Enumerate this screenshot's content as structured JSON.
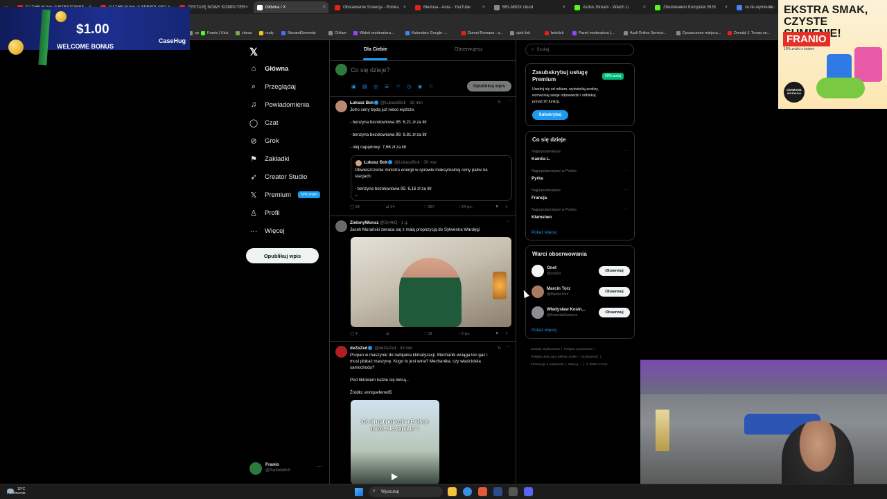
{
  "browser": {
    "tabs": [
      {
        "label": "DJ THE M live at RZESZOWSK",
        "color": "#e62117"
      },
      {
        "label": "DJ THE M live at SPEEDLAND",
        "color": "#e62117"
      },
      {
        "label": "TESTUJĘ NOWY KOMPUTER",
        "color": "#e62117"
      },
      {
        "label": "Główna / X",
        "color": "#ffffff",
        "active": true
      },
      {
        "label": "Obstawianie Szwecja - Polska",
        "color": "#e62117"
      },
      {
        "label": "Medusa - Aura - YouTube",
        "color": "#e62117"
      },
      {
        "label": "BELABOX cloud",
        "color": "#888888"
      },
      {
        "label": "Azdus Stream - Watch Li",
        "color": "#53fc18"
      },
      {
        "label": "Zbudowałem Komputer BUS",
        "color": "#53fc18"
      },
      {
        "label": "co ile wymienia się",
        "color": "#4285f4"
      }
    ],
    "bookmarks": [
      {
        "label": "op",
        "color": "#888888"
      },
      {
        "label": "Franio | Kick",
        "color": "#53fc18"
      },
      {
        "label": "chess",
        "color": "#7fa650"
      },
      {
        "label": "nudy",
        "color": "#f5c518"
      },
      {
        "label": "StreamElements",
        "color": "#4b6bfb"
      },
      {
        "label": "Chilam",
        "color": "#888888"
      },
      {
        "label": "Widok moderatora...",
        "color": "#9146ff"
      },
      {
        "label": "Kalendarz Google -...",
        "color": "#4285f4"
      },
      {
        "label": "Domni Romana - a...",
        "color": "#e62117"
      },
      {
        "label": "ujeb link",
        "color": "#888888"
      },
      {
        "label": "betclick",
        "color": "#e62117"
      },
      {
        "label": "Panel moderatora |...",
        "color": "#9146ff"
      },
      {
        "label": "Audi Online Service...",
        "color": "#888888"
      },
      {
        "label": "Opuszczone miejsca...",
        "color": "#888888"
      },
      {
        "label": "Donald J. Trump ne...",
        "color": "#e62117"
      }
    ]
  },
  "ads": {
    "left": {
      "amount": "$1.00",
      "bonus": "WELCOME BONUS",
      "brand": "CaseHug"
    },
    "right": {
      "headline": "EKSTRA SMAK, CZYSTE SUMIENIE!",
      "brand": "FRANIO",
      "sub": "10% zniżki z kodem",
      "badge": "DARMOWA WYSYŁKA"
    }
  },
  "nav": {
    "logo": "𝕏",
    "items": [
      {
        "label": "Główna",
        "icon": "home-icon",
        "glyph": "⌂"
      },
      {
        "label": "Przeglądaj",
        "icon": "search-icon",
        "glyph": "⌕"
      },
      {
        "label": "Powiadomienia",
        "icon": "bell-icon",
        "glyph": "♫"
      },
      {
        "label": "Czat",
        "icon": "chat-icon",
        "glyph": "◯"
      },
      {
        "label": "Grok",
        "icon": "grok-icon",
        "glyph": "⊘"
      },
      {
        "label": "Zakładki",
        "icon": "bookmark-icon",
        "glyph": "⚑"
      },
      {
        "label": "Creator Studio",
        "icon": "rocket-icon",
        "glyph": "➶"
      },
      {
        "label": "Premium",
        "icon": "x-icon",
        "glyph": "𝕏",
        "badge": "50% zniżki"
      },
      {
        "label": "Profil",
        "icon": "profile-icon",
        "glyph": "♙"
      },
      {
        "label": "Więcej",
        "icon": "more-icon",
        "glyph": "⋯"
      }
    ],
    "post_button": "Opublikuj wpis",
    "account": {
      "name": "Franio",
      "handle": "@franiotwitch",
      "more": "···"
    }
  },
  "feed": {
    "tabs": [
      "Dla Ciebie",
      "Obserwujesz"
    ],
    "composer_placeholder": "Co się dzieje?",
    "composer_post": "Opublikuj wpis",
    "posts": [
      {
        "author": "Łukasz Bok",
        "handle": "@LukaszBok",
        "time": "· 19 min",
        "lines": [
          "Jutro ceny będą już nieco wyższe.",
          "- benzyna bezołowiowa 95: 6,21 zł za litr",
          "- benzyna bezołowiowa 98: 6,81 zł za litr",
          "- olej napędowy: 7,66 zł za litr"
        ],
        "quote": {
          "author": "Łukasz Bok",
          "handle": "@LukaszBok",
          "time": "· 30 mar",
          "lines": [
            "Obwieszczenie ministra energii w sprawie maksymalnej ceny paliw na",
            "stacjach:",
            "- benzyna bezołowiowa 95: 6,16 zł za litr",
            "..."
          ]
        },
        "stats": {
          "replies": "38",
          "reposts": "14",
          "likes": "257",
          "views": "24 tys."
        }
      },
      {
        "author": "ZielonyWonsz",
        "handle": "@Sn4kQ",
        "time": "· 1 g.",
        "lines": [
          "Jacek Murański zwraca się z małą propozycją do Sylwestra Wardęgi"
        ],
        "stats": {
          "replies": "4",
          "reposts": "",
          "likes": "18",
          "views": "2 tys."
        }
      },
      {
        "author": "deZeZed",
        "handle": "@deZeZed",
        "time": "· 33 min",
        "lines": [
          "Propan w maszynie do nabijania klimatyzacji. Mechanik wciąga ten gaz i",
          "musi płukać maszynę. Kogo to jest wina? Mechanika, czy właściciela",
          "samochodu?",
          "Pod tiktokiem ludzie się kłócą...",
          "Źródło: enriqueferrell5"
        ],
        "video_caption": "Co drugi pojazd w Polsce może się zapalić ?"
      }
    ]
  },
  "sidebar": {
    "search_placeholder": "Szukaj",
    "premium": {
      "title": "Zasubskrybuj usługę Premium",
      "pill": "50% taniej",
      "desc": [
        "Uwolnij się od reklam, wyświetlaj analizy,",
        "wzmacniaj swoje odpowiedzi i odblokuj",
        "ponad 20 funkcji."
      ],
      "button": "Subskrybuj"
    },
    "trends": {
      "title": "Co się dzieje",
      "items": [
        {
          "context": "Najpopularniejsze",
          "name": "Kamila L."
        },
        {
          "context": "Najpopularniejsze w Polska",
          "name": "Pyrka"
        },
        {
          "context": "Najpopularniejsze",
          "name": "Francja"
        },
        {
          "context": "Najpopularniejsze w Polska",
          "name": "Kłamstwo"
        }
      ],
      "more": "Pokaż więcej"
    },
    "who_to_follow": {
      "title": "Warci obserwowania",
      "items": [
        {
          "name": "Onet",
          "handle": "@onetpl",
          "button": "Obserwuj",
          "color": "#f5f5f5"
        },
        {
          "name": "Marcin Torz",
          "handle": "@MarcinTorz",
          "button": "Obserwuj",
          "color": "#a87c64"
        },
        {
          "name": "Władysław Kosin...",
          "handle": "@KosiniakKamysz",
          "button": "Obserwuj",
          "color": "#8d8d94"
        }
      ],
      "more": "Pokaż więcej"
    },
    "footer": [
      "Zasady użytkowania",
      "Polityka prywatności",
      "Polityka dotycząca plików cookie",
      "Dostępność",
      "Informacje o reklamach",
      "Więcej ···",
      "© 2026 X Corp."
    ]
  },
  "taskbar": {
    "weather_temp": "10°C",
    "weather_desc": "Pochmurnie",
    "search": "Wyszukaj"
  }
}
